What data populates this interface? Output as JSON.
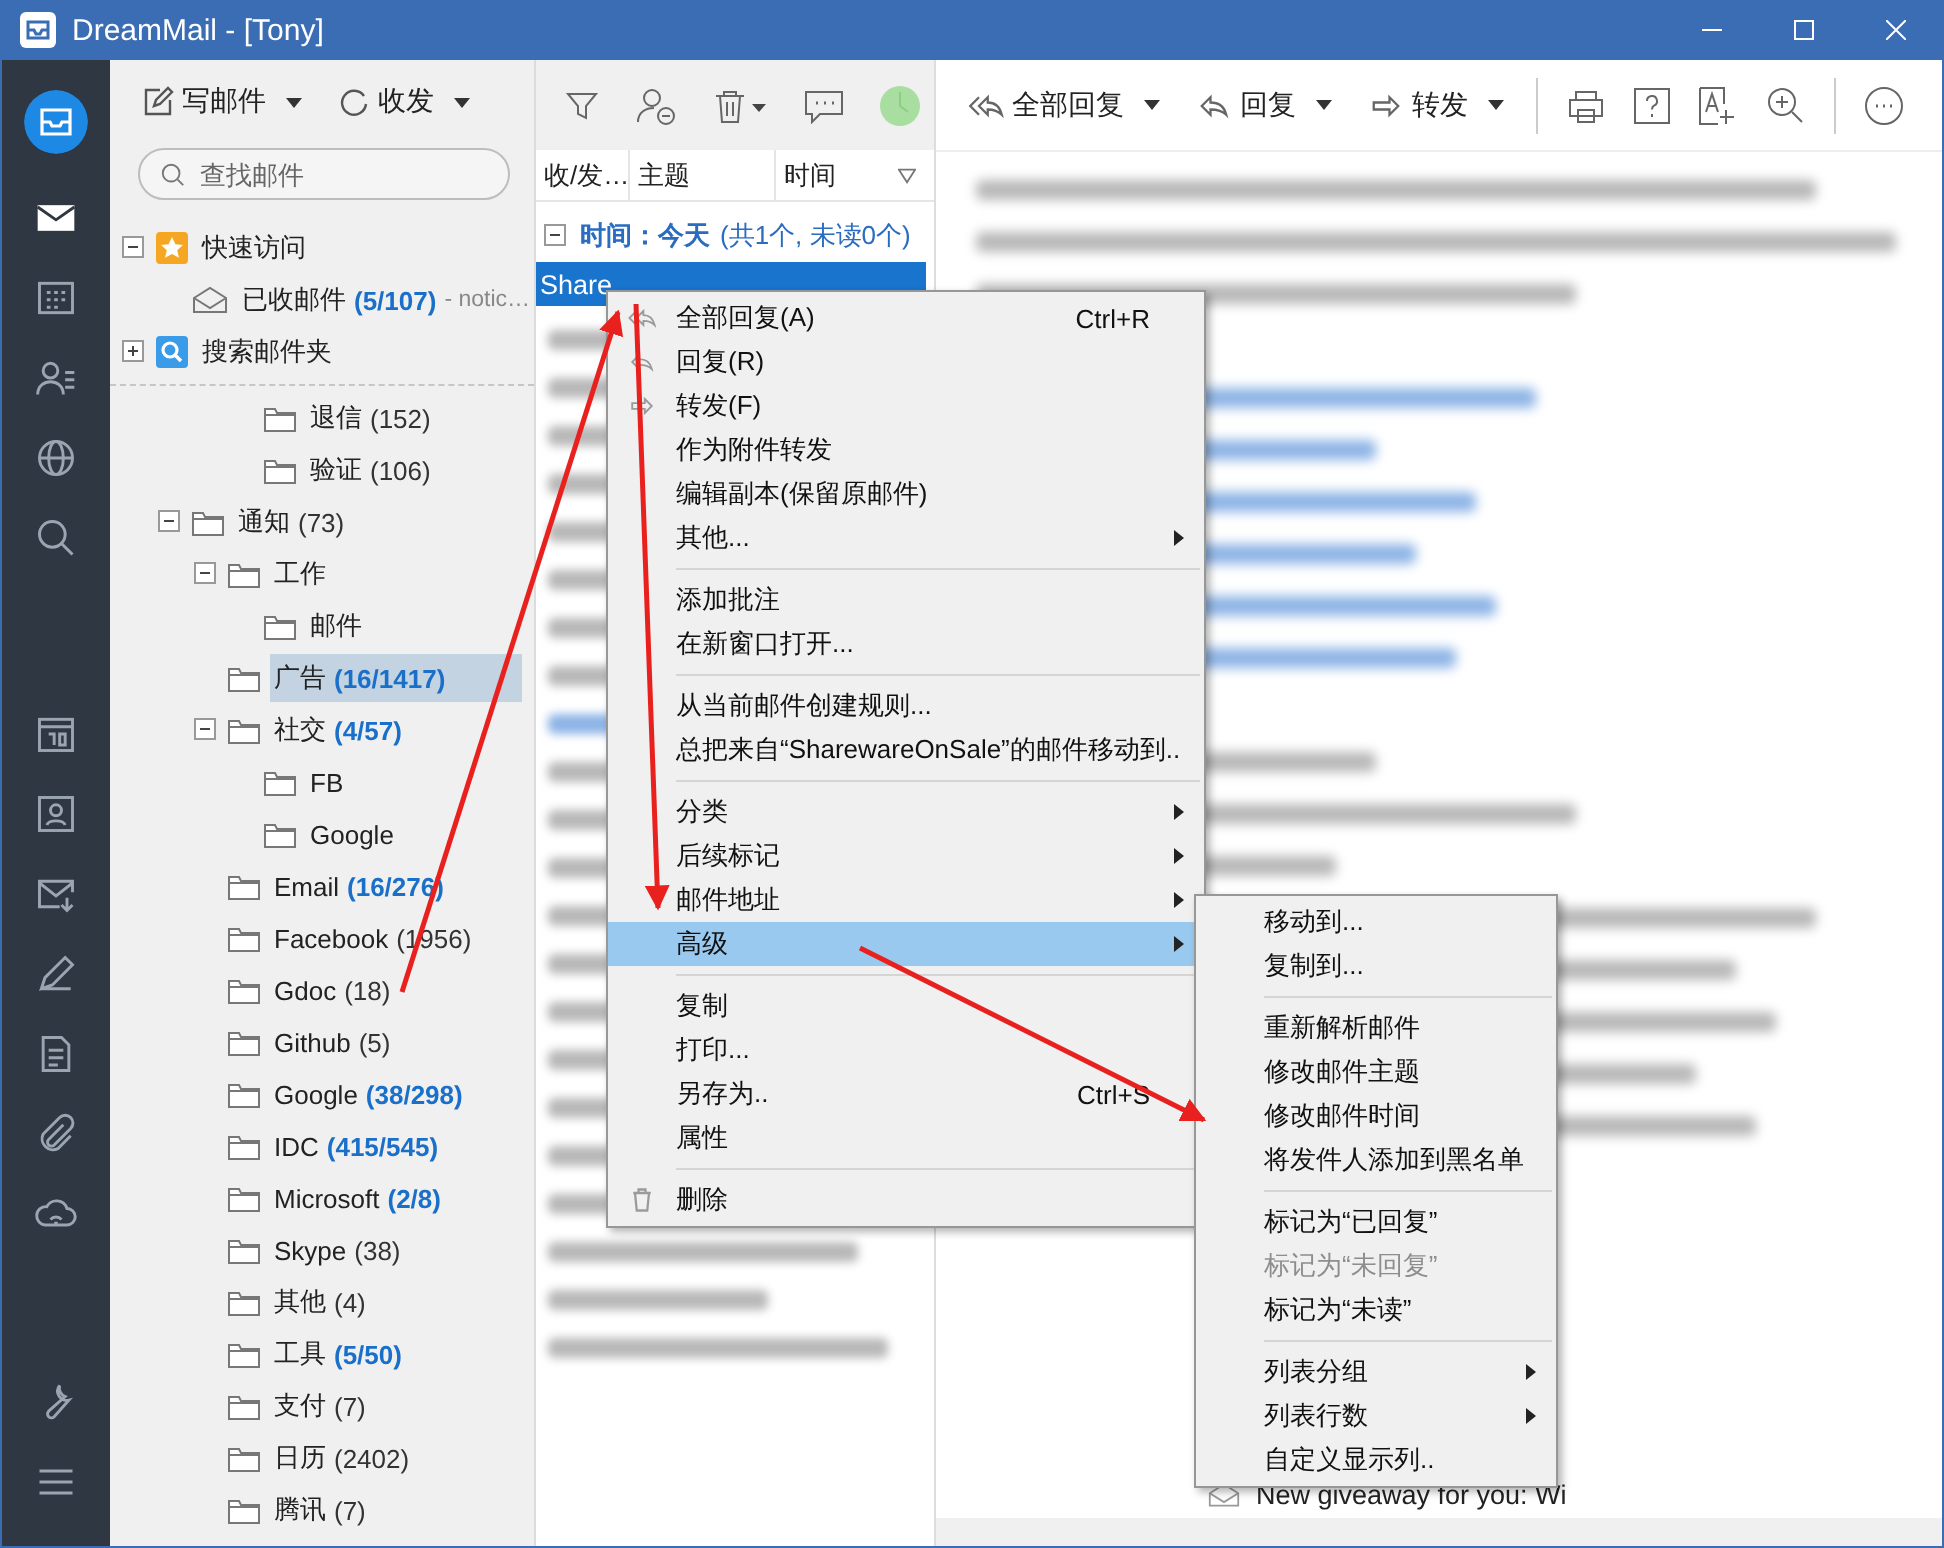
{
  "window": {
    "title": "DreamMail - [Tony]"
  },
  "nav_rail": {
    "top": [
      {
        "kind": "mail",
        "selected": true
      },
      {
        "kind": "calendar-grid",
        "selected": false
      },
      {
        "kind": "contacts",
        "selected": false
      },
      {
        "kind": "globe",
        "selected": false
      },
      {
        "kind": "search",
        "selected": false
      }
    ],
    "middle": [
      {
        "kind": "calendar-day",
        "selected": false
      },
      {
        "kind": "contact-card",
        "selected": false
      },
      {
        "kind": "mail-down",
        "selected": false
      },
      {
        "kind": "pen",
        "selected": false
      },
      {
        "kind": "document",
        "selected": false
      },
      {
        "kind": "paperclip",
        "selected": false
      },
      {
        "kind": "cloud",
        "selected": false
      }
    ],
    "bottom": [
      {
        "kind": "wrench",
        "selected": false
      },
      {
        "kind": "menu",
        "selected": false
      }
    ]
  },
  "folder_toolbar": {
    "buttons": [
      {
        "label": "写邮件",
        "kind": "compose"
      },
      {
        "label": "收发",
        "kind": "sync"
      }
    ]
  },
  "search": {
    "placeholder": "查找邮件"
  },
  "folder_tree": {
    "pinned": [
      {
        "name": "快速访问",
        "kind": "star",
        "expanded": true,
        "selected": false,
        "children": [
          {
            "name": "已收邮件",
            "kind": "inbox",
            "count": "(5/107)",
            "unread": true,
            "note": "- notic…",
            "selected": false
          }
        ]
      },
      {
        "name": "搜索邮件夹",
        "kind": "search",
        "expanded": false,
        "selected": false
      }
    ],
    "folders": [
      {
        "children": [
          {
            "children": [
              {
                "name": "退信",
                "count": "(152)",
                "unread": false,
                "selected": false
              },
              {
                "name": "验证",
                "count": "(106)",
                "unread": false,
                "selected": false
              }
            ]
          }
        ]
      },
      {
        "name": "通知",
        "count": "(73)",
        "unread": false,
        "expanded": true,
        "selected": false,
        "children": [
          {
            "name": "工作",
            "expanded": true,
            "selected": false,
            "children": [
              {
                "name": "邮件",
                "selected": false
              }
            ]
          },
          {
            "name": "广告",
            "count": "(16/1417)",
            "unread": true,
            "selected": true
          },
          {
            "name": "社交",
            "count": "(4/57)",
            "unread": true,
            "expanded": true,
            "selected": false,
            "children": [
              {
                "name": "FB",
                "selected": false
              },
              {
                "name": "Google",
                "selected": false
              }
            ]
          },
          {
            "name": "Email",
            "count": "(16/276)",
            "unread": true,
            "selected": false
          },
          {
            "name": "Facebook",
            "count": "(1956)",
            "unread": false,
            "selected": false
          },
          {
            "name": "Gdoc",
            "count": "(18)",
            "unread": false,
            "selected": false
          },
          {
            "name": "Github",
            "count": "(5)",
            "unread": false,
            "selected": false
          },
          {
            "name": "Google",
            "count": "(38/298)",
            "unread": true,
            "selected": false
          },
          {
            "name": "IDC",
            "count": "(415/545)",
            "unread": true,
            "selected": false
          },
          {
            "name": "Microsoft",
            "count": "(2/8)",
            "unread": true,
            "selected": false
          },
          {
            "name": "Skype",
            "count": "(38)",
            "unread": false,
            "selected": false
          },
          {
            "name": "其他",
            "count": "(4)",
            "unread": false,
            "selected": false
          },
          {
            "name": "工具",
            "count": "(5/50)",
            "unread": true,
            "selected": false
          },
          {
            "name": "支付",
            "count": "(7)",
            "unread": false,
            "selected": false
          },
          {
            "name": "日历",
            "count": "(2402)",
            "unread": false,
            "selected": false
          },
          {
            "name": "腾讯",
            "count": "(7)",
            "unread": false,
            "selected": false
          }
        ]
      }
    ]
  },
  "message_list": {
    "columns": [
      "收/发…",
      "主题",
      "时间"
    ],
    "group": {
      "label": "时间：今天",
      "summary": "(共1个, 未读0个)",
      "expanded": true
    },
    "rows": [
      {
        "sender": "Share",
        "selected": true
      }
    ]
  },
  "reading_toolbar": {
    "buttons": [
      {
        "label": "全部回复",
        "kind": "reply-all"
      },
      {
        "label": "回复",
        "kind": "reply"
      },
      {
        "label": "转发",
        "kind": "forward"
      }
    ]
  },
  "reading_pane": {
    "last_row": {
      "subject": "New giveaway for you: Wi"
    }
  },
  "context_menu": {
    "items": [
      {
        "kind": "reply-all",
        "label": "全部回复(A)",
        "shortcut": "Ctrl+R",
        "submenu": false,
        "selected": false
      },
      {
        "kind": "reply",
        "label": "回复(R)",
        "submenu": false,
        "selected": false
      },
      {
        "kind": "forward",
        "label": "转发(F)",
        "submenu": false,
        "selected": false
      },
      {
        "kind": "item",
        "label": "作为附件转发",
        "submenu": false,
        "selected": false
      },
      {
        "kind": "item",
        "label": "编辑副本(保留原邮件)",
        "submenu": false,
        "selected": false
      },
      {
        "kind": "item",
        "label": "其他...",
        "submenu": true,
        "selected": false
      },
      {
        "kind": "separator"
      },
      {
        "kind": "item",
        "label": "添加批注",
        "submenu": false,
        "selected": false
      },
      {
        "kind": "item",
        "label": "在新窗口打开...",
        "submenu": false,
        "selected": false
      },
      {
        "kind": "separator"
      },
      {
        "kind": "item",
        "label": "从当前邮件创建规则...",
        "submenu": false,
        "selected": false
      },
      {
        "kind": "item",
        "label": "总把来自“SharewareOnSale”的邮件移动到..",
        "submenu": false,
        "selected": false
      },
      {
        "kind": "separator"
      },
      {
        "kind": "item",
        "label": "分类",
        "submenu": true,
        "selected": false
      },
      {
        "kind": "item",
        "label": "后续标记",
        "submenu": true,
        "selected": false
      },
      {
        "kind": "item",
        "label": "邮件地址",
        "submenu": true,
        "selected": false
      },
      {
        "kind": "item",
        "label": "高级",
        "submenu": true,
        "selected": true
      },
      {
        "kind": "separator"
      },
      {
        "kind": "item",
        "label": "复制",
        "submenu": false,
        "selected": false
      },
      {
        "kind": "item",
        "label": "打印...",
        "submenu": false,
        "selected": false
      },
      {
        "kind": "item",
        "label": "另存为..",
        "shortcut": "Ctrl+S",
        "submenu": false,
        "selected": false
      },
      {
        "kind": "item",
        "label": "属性",
        "submenu": false,
        "selected": false
      },
      {
        "kind": "separator"
      },
      {
        "kind": "delete",
        "label": "删除",
        "submenu": false,
        "selected": false
      }
    ]
  },
  "submenu": {
    "items": [
      {
        "kind": "item",
        "label": "移动到...",
        "submenu": false,
        "disabled": false
      },
      {
        "kind": "item",
        "label": "复制到...",
        "submenu": false,
        "disabled": false
      },
      {
        "kind": "separator"
      },
      {
        "kind": "item",
        "label": "重新解析邮件",
        "submenu": false,
        "disabled": false
      },
      {
        "kind": "item",
        "label": "修改邮件主题",
        "submenu": false,
        "disabled": false
      },
      {
        "kind": "item",
        "label": "修改邮件时间",
        "submenu": false,
        "disabled": false
      },
      {
        "kind": "item",
        "label": "将发件人添加到黑名单",
        "submenu": false,
        "disabled": false
      },
      {
        "kind": "separator"
      },
      {
        "kind": "item",
        "label": "标记为“已回复”",
        "submenu": false,
        "disabled": false
      },
      {
        "kind": "item",
        "label": "标记为“未回复”",
        "submenu": false,
        "disabled": true
      },
      {
        "kind": "item",
        "label": "标记为“未读”",
        "submenu": false,
        "disabled": false
      },
      {
        "kind": "separator"
      },
      {
        "kind": "item",
        "label": "列表分组",
        "submenu": true,
        "disabled": false
      },
      {
        "kind": "item",
        "label": "列表行数",
        "submenu": true,
        "disabled": false
      },
      {
        "kind": "item",
        "label": "自定义显示列..",
        "submenu": false,
        "disabled": false
      }
    ]
  }
}
